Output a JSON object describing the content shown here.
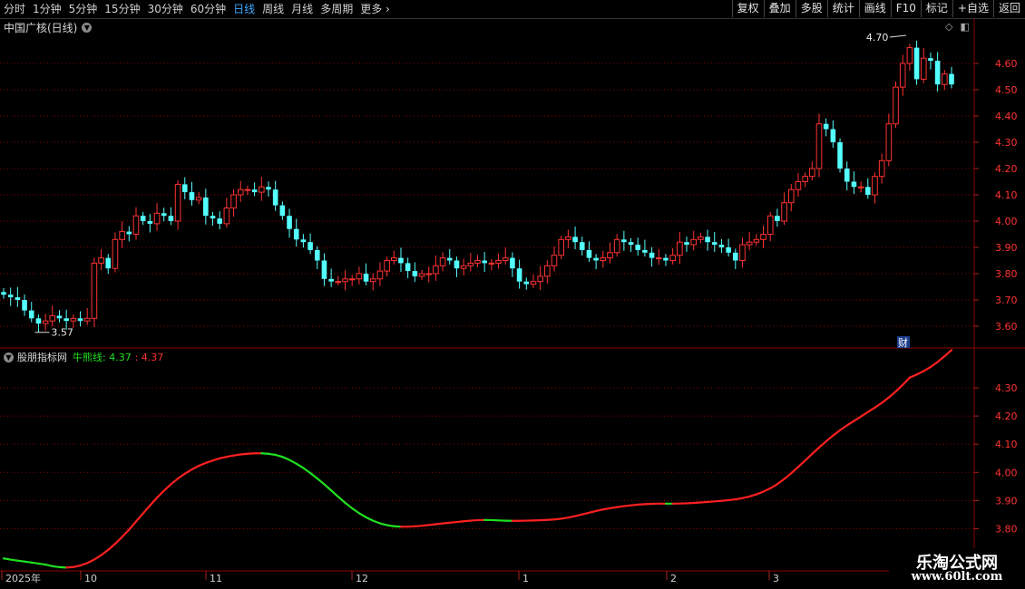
{
  "toolbar": {
    "periods": [
      "分时",
      "1分钟",
      "5分钟",
      "15分钟",
      "30分钟",
      "60分钟",
      "日线",
      "周线",
      "月线",
      "多周期",
      "更多"
    ],
    "active_period": "日线",
    "right_buttons": [
      "复权",
      "叠加",
      "多股",
      "统计",
      "画线",
      "F10",
      "标记",
      "+自选",
      "返回"
    ]
  },
  "main_chart": {
    "title": "中国广核(日线)",
    "high_label": "4.70",
    "low_label": "3.57",
    "fin_marker": "财",
    "price_axis": [
      "4.60",
      "4.50",
      "4.40",
      "4.30",
      "4.20",
      "4.10",
      "4.00",
      "3.90",
      "3.80",
      "3.70",
      "3.60"
    ]
  },
  "indicator": {
    "name": "股朋指标网",
    "line_label": "牛熊线",
    "value_green": "4.37",
    "value_red": "4.37",
    "axis": [
      "4.30",
      "4.20",
      "4.10",
      "4.00",
      "3.90",
      "3.80"
    ]
  },
  "date_axis": [
    "2025年",
    "10",
    "11",
    "12",
    "1",
    "2",
    "3"
  ],
  "watermark": {
    "line1": "乐淘公式网",
    "line2": "www.60lt.com"
  },
  "colors": {
    "up": "#ff3232",
    "down": "#54ffff",
    "bull": "#ff2020",
    "bear": "#20e020",
    "grid": "#8b0000"
  },
  "chart_data": {
    "type": "candlestick",
    "y_range": [
      3.55,
      4.72
    ],
    "close": [
      3.72,
      3.71,
      3.7,
      3.66,
      3.63,
      3.61,
      3.62,
      3.64,
      3.63,
      3.62,
      3.63,
      3.62,
      3.63,
      3.84,
      3.86,
      3.82,
      3.93,
      3.96,
      3.95,
      4.02,
      4.0,
      3.99,
      4.03,
      4.02,
      4.0,
      4.14,
      4.11,
      4.08,
      4.09,
      4.02,
      4.01,
      3.99,
      4.05,
      4.1,
      4.12,
      4.12,
      4.11,
      4.13,
      4.12,
      4.06,
      4.02,
      3.97,
      3.93,
      3.92,
      3.89,
      3.85,
      3.78,
      3.77,
      3.77,
      3.78,
      3.78,
      3.8,
      3.77,
      3.78,
      3.81,
      3.85,
      3.86,
      3.84,
      3.81,
      3.79,
      3.8,
      3.8,
      3.83,
      3.86,
      3.85,
      3.82,
      3.83,
      3.84,
      3.85,
      3.84,
      3.84,
      3.85,
      3.86,
      3.82,
      3.77,
      3.76,
      3.77,
      3.79,
      3.83,
      3.87,
      3.93,
      3.94,
      3.92,
      3.89,
      3.86,
      3.85,
      3.86,
      3.88,
      3.93,
      3.92,
      3.91,
      3.89,
      3.88,
      3.86,
      3.86,
      3.85,
      3.87,
      3.92,
      3.91,
      3.93,
      3.94,
      3.92,
      3.91,
      3.9,
      3.88,
      3.85,
      3.91,
      3.92,
      3.93,
      3.95,
      4.02,
      4.0,
      4.07,
      4.12,
      4.15,
      4.17,
      4.2,
      4.37,
      4.35,
      4.3,
      4.2,
      4.15,
      4.13,
      4.13,
      4.1,
      4.17,
      4.23,
      4.37,
      4.51,
      4.6,
      4.66,
      4.54,
      4.62,
      4.61,
      4.52,
      4.56,
      4.52
    ]
  }
}
